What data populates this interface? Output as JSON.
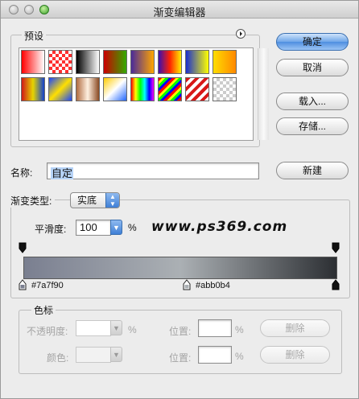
{
  "window": {
    "title": "渐变编辑器"
  },
  "presets": {
    "legend": "预设",
    "swatches": [
      "linear-gradient(90deg,#ff0000,#ffffff)",
      "repeating-conic-gradient(#ff3030 0 25%,#ffffff 0 50%) 0 0/8px 8px",
      "linear-gradient(90deg,#000000,#ffffff)",
      "linear-gradient(90deg,#cc0000,#33aa00)",
      "linear-gradient(90deg,#4a2a9a,#ffa500)",
      "linear-gradient(90deg,#3a0fb0,#ff2200,#ffee00)",
      "linear-gradient(90deg,#1a2fd0,#ffff00)",
      "linear-gradient(90deg,#ffdd00,#ff8800)",
      "linear-gradient(90deg,#d01818,#e6d400,#1040d0)",
      "linear-gradient(135deg,#1a46ff,#ffe000,#1a46ff)",
      "linear-gradient(90deg,#b06b40,#fff0e0,#8a4a22)",
      "linear-gradient(135deg,#ffcc00,#ffffff,#2266ff)",
      "linear-gradient(90deg,#ff0000,#ffff00,#00ff00,#00ffff,#0000ff,#ff00ff)",
      "repeating-linear-gradient(135deg,#ff0000 0 3px,#ffff00 3px 6px,#00ff00 6px 9px,#0000ff 9px 12px)",
      "repeating-linear-gradient(135deg,#d81818 0 4px,#ffffff 4px 8px)",
      "repeating-conic-gradient(#cccccc 0 25%,#ffffff 0 50%) 0 0/8px 8px"
    ]
  },
  "buttons": {
    "ok": "确定",
    "cancel": "取消",
    "load": "载入...",
    "save": "存储...",
    "new": "新建"
  },
  "name": {
    "label": "名称:",
    "value": "自定"
  },
  "gradient": {
    "type_label": "渐变类型:",
    "type_value": "实底",
    "smoothness_label": "平滑度:",
    "smoothness_value": "100",
    "percent": "%",
    "stops": [
      {
        "color": "#7a7f90",
        "location": 0
      },
      {
        "color": "#abb0b4",
        "location": 50
      },
      {
        "color": "#2c2f33",
        "location": 100
      }
    ],
    "stop_label_left": "#7a7f90",
    "stop_label_mid": "#abb0b4"
  },
  "watermark": "www.ps369.com",
  "color_stop": {
    "legend": "色标",
    "opacity_label": "不透明度:",
    "color_label": "颜色:",
    "location_label": "位置:",
    "percent": "%",
    "delete_label": "删除"
  },
  "colors": {
    "accent": "#4e8ee0"
  }
}
